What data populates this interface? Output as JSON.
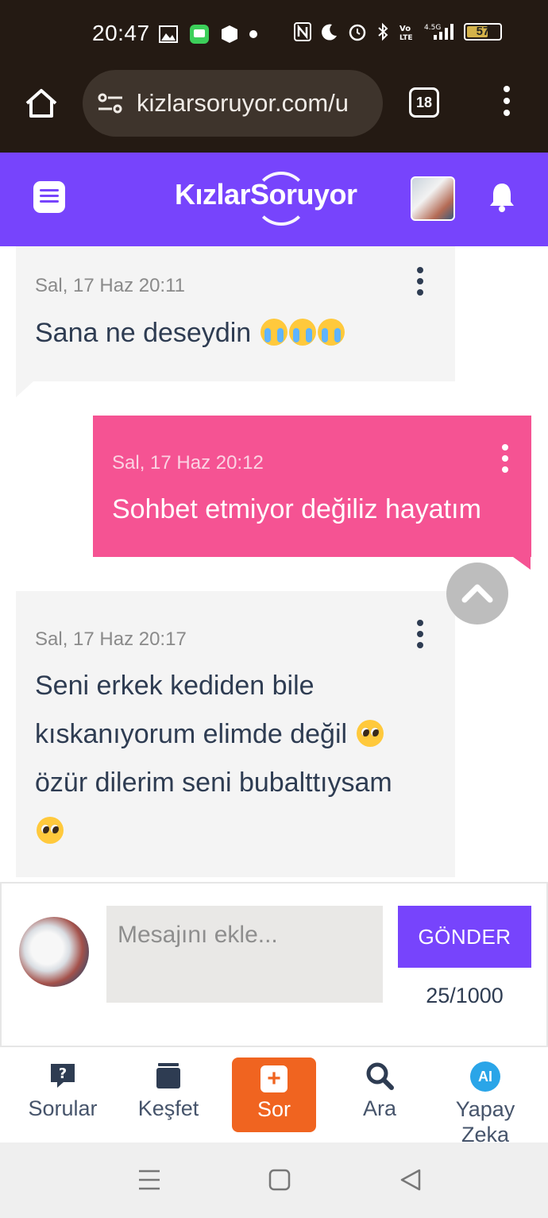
{
  "status_bar": {
    "time": "20:47",
    "battery": "57",
    "network": "4.5G"
  },
  "browser": {
    "url": "kizlarsoruyor.com/u",
    "tab_count": "18"
  },
  "app": {
    "logo_text": "KızlarSoruyor",
    "brand_color": "#7744fc"
  },
  "messages": [
    {
      "direction": "in",
      "timestamp": "Sal, 17 Haz 20:11",
      "lines": [
        "Sana ne deseydin"
      ],
      "emojis": [
        "loudly-crying",
        "loudly-crying",
        "loudly-crying"
      ]
    },
    {
      "direction": "out",
      "timestamp": "Sal, 17 Haz 20:12",
      "lines": [
        "Sohbet etmiyor değiliz hayatım"
      ]
    },
    {
      "direction": "in",
      "timestamp": "Sal, 17 Haz 20:17",
      "lines": [
        "Seni erkek kediden bile",
        "kıskanıyorum elimde değil",
        "özür dilerim seni bubalttıysam"
      ],
      "emojis": [
        "pleading-face",
        "pleading-face"
      ]
    }
  ],
  "composer": {
    "placeholder": "Mesajını ekle...",
    "send_label": "GÖNDER",
    "counter": "25/1000"
  },
  "bottom_nav": {
    "sorular": "Sorular",
    "kesfet": "Keşfet",
    "sor": "Sor",
    "ara": "Ara",
    "yapay_zeka": "Yapay Zeka",
    "ai_badge": "AI"
  },
  "colors": {
    "incoming_bubble": "#f4f4f4",
    "outgoing_bubble": "#f55393",
    "accent": "#f06420"
  }
}
